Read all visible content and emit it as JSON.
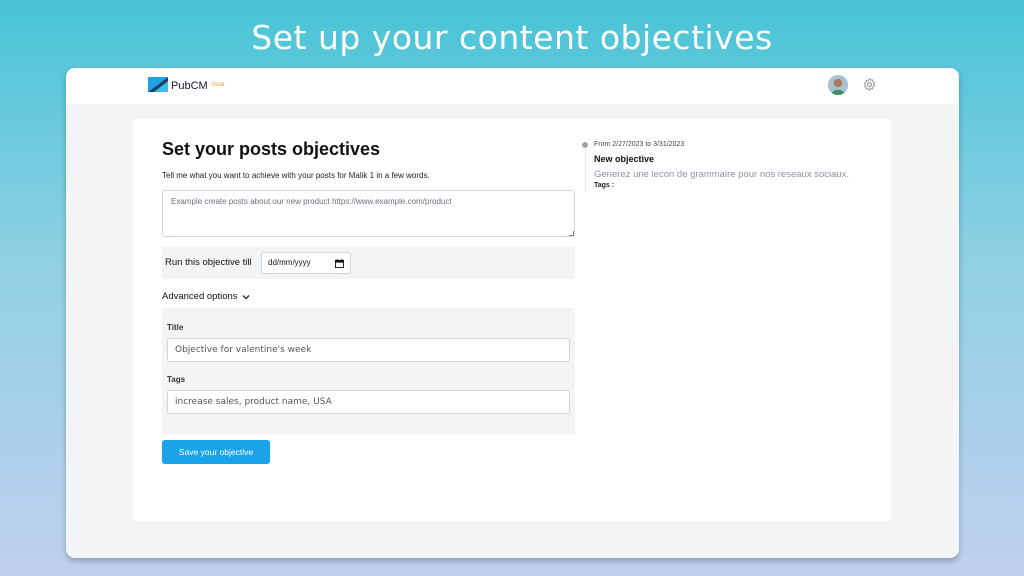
{
  "hero": {
    "title": "Set up your content objectives"
  },
  "header": {
    "brand": "PubCM",
    "beta": "Beta",
    "colors": {
      "logo_primary": "#1aa3e6",
      "logo_dark": "#1f3f5e"
    }
  },
  "form": {
    "title": "Set your posts objectives",
    "subtitle": "Tell me what you want to achieve with your posts for Malik 1 in a few words.",
    "description_placeholder": "Example create posts about our new product https://www.example.com/product",
    "description_value": "",
    "run_label": "Run this objective till",
    "date_value": "dd/mm/yyyy",
    "advanced_label": "Advanced options",
    "title_label": "Title",
    "title_placeholder": "Objective for valentine's week",
    "tags_label": "Tags",
    "tags_placeholder": "increase sales, product name, USA",
    "save_label": "Save your objective",
    "save_color": "#1aa3e6"
  },
  "timeline": {
    "items": [
      {
        "date_range": "From 2/27/2023 to 3/31/2023",
        "title": "New objective",
        "description": "Generez une lecon de grammaire pour nos reseaux sociaux.",
        "tags_label": "Tags :"
      }
    ]
  },
  "icons": [
    "logo-icon",
    "avatar",
    "gear-icon",
    "calendar-icon",
    "chevron-down-icon"
  ]
}
